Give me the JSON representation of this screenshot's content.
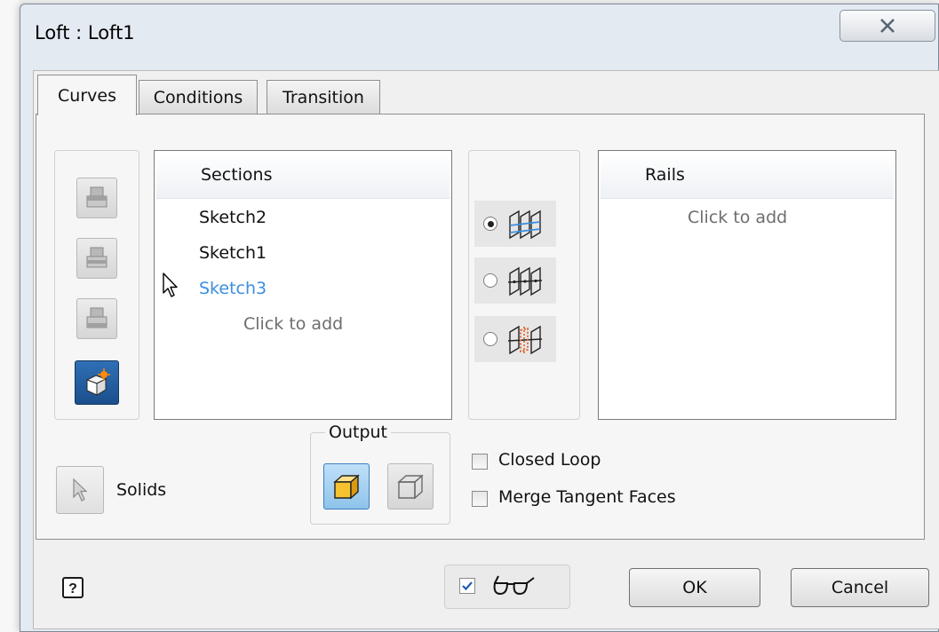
{
  "window": {
    "title": "Loft : Loft1",
    "close_icon": "close-x-icon"
  },
  "tabs": [
    {
      "label": "Curves",
      "active": true
    },
    {
      "label": "Conditions",
      "active": false
    },
    {
      "label": "Transition",
      "active": false
    }
  ],
  "sections": {
    "header": "Sections",
    "items": [
      {
        "label": "Sketch2",
        "color": "#111111"
      },
      {
        "label": "Sketch1",
        "color": "#111111"
      },
      {
        "label": "Sketch3",
        "color": "#3b8fe0"
      }
    ],
    "hint": "Click to add"
  },
  "rails": {
    "header": "Rails",
    "hint": "Click to add"
  },
  "toolbar_icons": [
    "section-up-icon",
    "section-middle-icon",
    "section-down-icon",
    "create-sketch-icon"
  ],
  "mode_options": [
    {
      "icon": "rails-mode-icon",
      "selected": true
    },
    {
      "icon": "centerline-mode-icon",
      "selected": false
    },
    {
      "icon": "area-loft-mode-icon",
      "selected": false
    }
  ],
  "solids": {
    "label": "Solids",
    "icon": "select-arrow-icon"
  },
  "output": {
    "legend": "Output",
    "solid_icon": "solid-output-icon",
    "surface_icon": "surface-output-icon",
    "selected": "solid"
  },
  "options": {
    "closed_loop": {
      "label": "Closed Loop",
      "checked": false
    },
    "merge_tangent": {
      "label": "Merge Tangent Faces",
      "checked": false
    }
  },
  "footer": {
    "help_icon": "help-icon",
    "preview": {
      "checked": true,
      "icon": "glasses-preview-icon"
    },
    "ok_label": "OK",
    "cancel_label": "Cancel"
  },
  "colors": {
    "accent": "#3b8fe0",
    "dialog_bg": "#e4eaf2",
    "panel_bg": "#f6f6f6"
  }
}
